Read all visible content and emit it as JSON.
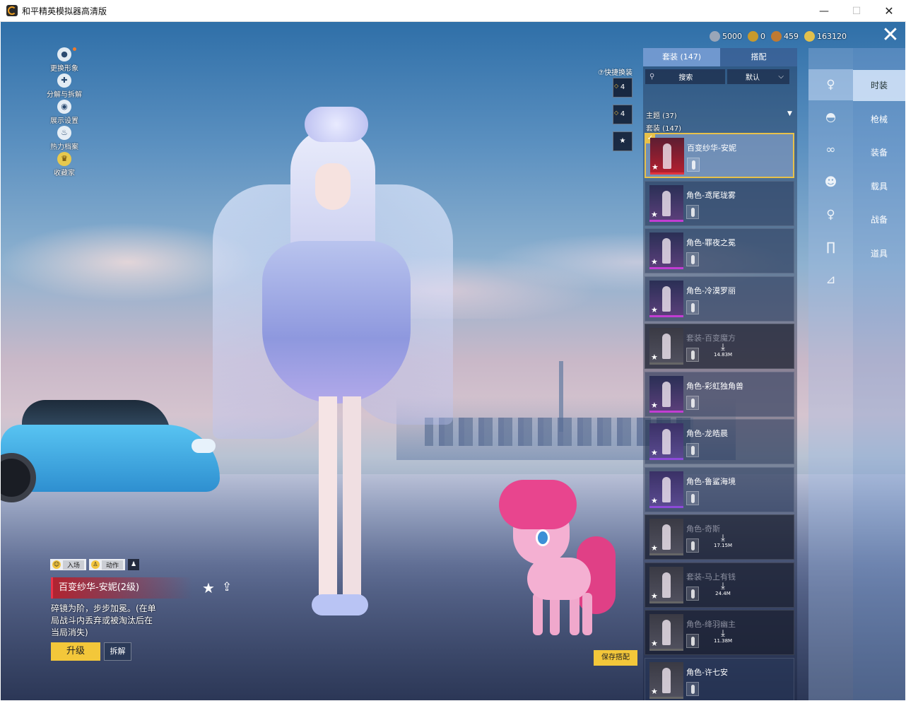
{
  "window": {
    "title": "和平精英模拟器高清版",
    "min": "—",
    "max": "☐",
    "close": "✕"
  },
  "colors": {
    "accent_gold": "#f3c73a",
    "selected_border": "#e8c14a",
    "title_red": "#b02431"
  },
  "left_menu": [
    {
      "label": "更换形象",
      "icon": "person-icon",
      "glyph": "●",
      "has_dot": true
    },
    {
      "label": "分解与拆解",
      "icon": "puzzle-icon",
      "glyph": "✚"
    },
    {
      "label": "展示设置",
      "icon": "eye-icon",
      "glyph": "◉"
    },
    {
      "label": "热力档案",
      "icon": "flame-icon",
      "glyph": "♨"
    },
    {
      "label": "收藏家",
      "icon": "collector-badge-icon",
      "glyph": "♛"
    }
  ],
  "currency": [
    {
      "icon": "coin-silver-icon",
      "value": "5000",
      "color": "#9aa6b8"
    },
    {
      "icon": "badge-gold-icon",
      "value": "0",
      "color": "#c79a2c"
    },
    {
      "icon": "medal-bronze-icon",
      "value": "459",
      "color": "#c07a32"
    },
    {
      "icon": "coin-gold-icon",
      "value": "163120",
      "color": "#e2c04c"
    }
  ],
  "close_glyph": "✕",
  "quick_swap": {
    "label": "⑦快捷换装",
    "buttons": [
      "4",
      "4",
      "★"
    ]
  },
  "panel": {
    "tabs": [
      "套装 (147)",
      "搭配"
    ],
    "search_placeholder": "搜索",
    "sort": "默认",
    "theme_row": "主题 (37)",
    "set_row": "套装 (147)",
    "items": [
      {
        "name": "百变纱华-安妮",
        "style": "selected",
        "thumb": "red"
      },
      {
        "name": "角色-鸢尾珑雾",
        "style": "normal",
        "thumb": "pink"
      },
      {
        "name": "角色-罪夜之冕",
        "style": "normal",
        "thumb": "pink"
      },
      {
        "name": "角色-冷漠罗丽",
        "style": "normal",
        "thumb": "pink"
      },
      {
        "name": "套装-百变魔方",
        "style": "dim",
        "thumb": "gray",
        "download": "14.83M"
      },
      {
        "name": "角色-彩虹独角兽",
        "style": "normal",
        "thumb": "pink"
      },
      {
        "name": "角色-龙皓晨",
        "style": "normal",
        "thumb": "purple"
      },
      {
        "name": "角色-鲁鲨海境",
        "style": "normal",
        "thumb": "purple"
      },
      {
        "name": "角色-奇斯",
        "style": "dim",
        "thumb": "gray",
        "download": "17.15M"
      },
      {
        "name": "套装-马上有钱",
        "style": "dim",
        "thumb": "gray",
        "download": "24.4M"
      },
      {
        "name": "角色-绛羽幽主",
        "style": "dim",
        "thumb": "gray",
        "download": "11.38M"
      },
      {
        "name": "角色-许七安",
        "style": "normal",
        "thumb": "gray"
      }
    ]
  },
  "categories": [
    {
      "label": "时装",
      "icon": "outfit-icon",
      "glyph": "♀"
    },
    {
      "label": "枪械",
      "icon": "cap-icon",
      "glyph": "◓"
    },
    {
      "label": "装备",
      "icon": "goggles-icon",
      "glyph": "∞"
    },
    {
      "label": "载具",
      "icon": "mask-icon",
      "glyph": "☻"
    },
    {
      "label": "战备",
      "icon": "figure-icon",
      "glyph": "♀"
    },
    {
      "label": "道具",
      "icon": "pants-icon",
      "glyph": "∏"
    },
    {
      "label": "",
      "icon": "shoes-icon",
      "glyph": "⊿"
    }
  ],
  "item_info": {
    "action_enter": "入场",
    "action_move": "动作",
    "title": "百变纱华-安妮(2级)",
    "description": "碎镜为阶，步步加冕。(在单局战斗内丢弃或被淘汰后在当局消失)",
    "upgrade": "升级",
    "dismantle": "拆解",
    "fav_glyph": "★",
    "share_glyph": "⇪"
  },
  "save_button": "保存搭配"
}
